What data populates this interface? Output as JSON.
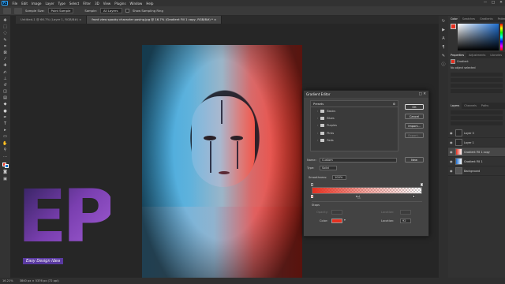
{
  "app": {
    "logo_text": "Ps"
  },
  "menu": [
    "File",
    "Edit",
    "Image",
    "Layer",
    "Type",
    "Select",
    "Filter",
    "3D",
    "View",
    "Plugins",
    "Window",
    "Help"
  ],
  "window_controls": [
    "—",
    "□",
    "✕"
  ],
  "options_bar": {
    "sample_size_label": "Sample Size:",
    "sample_size_value": "Point Sample",
    "sample_label": "Sample:",
    "sample_value": "All Layers",
    "show_ring_label": "Show Sampling Ring"
  },
  "tabs": [
    {
      "label": "Untitled-1 @ 66.7% (Layer 1, RGB/8#) ×"
    },
    {
      "label": "front view spooky character posing.jpg @ 16.7% (Gradient Fill 1 copy, RGB/8#) * ×"
    }
  ],
  "status_bar": {
    "zoom": "16.21%",
    "doc": "3840 px × 5376 px (72 ppi)"
  },
  "logo": {
    "letters": "EP",
    "tagline": "Easy Design Idea"
  },
  "right_panel": {
    "top_tabs": [
      "Color",
      "Swatches",
      "Gradients",
      "Patterns"
    ],
    "prop_tabs": [
      "Properties",
      "Adjustments",
      "Libraries"
    ],
    "prop_section": "Gradient",
    "prop_no_props": "No object selected",
    "layers_tabs": [
      "Layers",
      "Channels",
      "Paths"
    ],
    "layers": [
      {
        "name": "Layer 3",
        "thumb": "#2a2a2a",
        "selected": false
      },
      {
        "name": "Layer 1",
        "thumb": "#2a2a2a",
        "selected": false
      },
      {
        "name": "Gradient Fill 1 copy",
        "thumb": "#e53020",
        "selected": true
      },
      {
        "name": "Gradient Fill 1",
        "thumb": "#e53020",
        "selected": false
      },
      {
        "name": "Background",
        "thumb": "#555555",
        "selected": false
      }
    ]
  },
  "gradient_editor": {
    "title": "Gradient Editor",
    "presets_label": "Presets",
    "folders": [
      "Basics",
      "Blues",
      "Purples",
      "Pinks",
      "Reds"
    ],
    "buttons": {
      "ok": "OK",
      "cancel": "Cancel",
      "import": "Import...",
      "export": "Export...",
      "new": "New"
    },
    "name_label": "Name:",
    "name_value": "Custom",
    "type_label": "Type:",
    "type_value": "Solid",
    "smoothness_label": "Smoothness:",
    "smoothness_value": "100%",
    "stops_label": "Stops",
    "opacity_label": "Opacity:",
    "location_label": "Location:",
    "color_label": "Color:",
    "location_value": "92",
    "gradient_color": "#e53020"
  }
}
